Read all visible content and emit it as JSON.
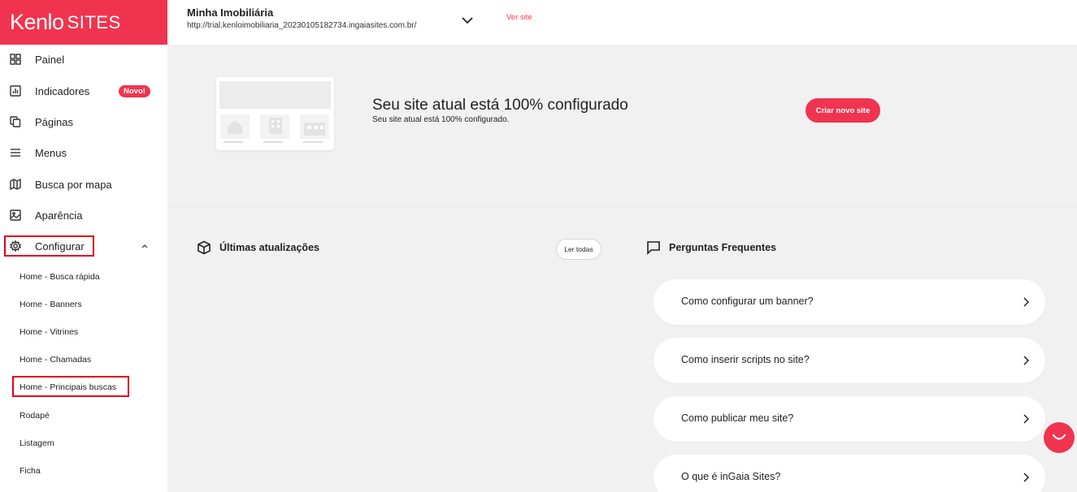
{
  "brand": {
    "name": "Kenlo",
    "product": "SITES"
  },
  "header": {
    "site_name": "Minha Imobiliária",
    "site_url": "http://trial.kenloimobiliaria_20230105182734.ingaiasites.com.br/",
    "view_site": "Ver site"
  },
  "sidebar": {
    "items": [
      {
        "label": "Painel",
        "icon": "grid-icon"
      },
      {
        "label": "Indicadores",
        "icon": "chart-icon",
        "badge": "Novo!"
      },
      {
        "label": "Páginas",
        "icon": "pages-icon"
      },
      {
        "label": "Menus",
        "icon": "menu-icon"
      },
      {
        "label": "Busca por mapa",
        "icon": "map-icon"
      },
      {
        "label": "Aparência",
        "icon": "image-icon"
      },
      {
        "label": "Configurar",
        "icon": "gear-icon",
        "expanded": true
      }
    ],
    "subitems": [
      "Home - Busca rápida",
      "Home - Banners",
      "Home - Vitrines",
      "Home - Chamadas",
      "Home - Principais buscas",
      "Rodapé",
      "Listagem",
      "Ficha"
    ]
  },
  "banner": {
    "title": "Seu site atual está 100% configurado",
    "subtitle": "Seu site atual está 100% configurado.",
    "button": "Criar novo site"
  },
  "updates": {
    "title": "Últimas atualizações",
    "read_all": "Ler todas"
  },
  "faq": {
    "title": "Perguntas Frequentes",
    "items": [
      "Como configurar um banner?",
      "Como inserir scripts no site?",
      "Como publicar meu site?",
      "O que é inGaia Sites?"
    ]
  },
  "colors": {
    "accent": "#f0344f",
    "highlight_box": "#e3001b"
  }
}
